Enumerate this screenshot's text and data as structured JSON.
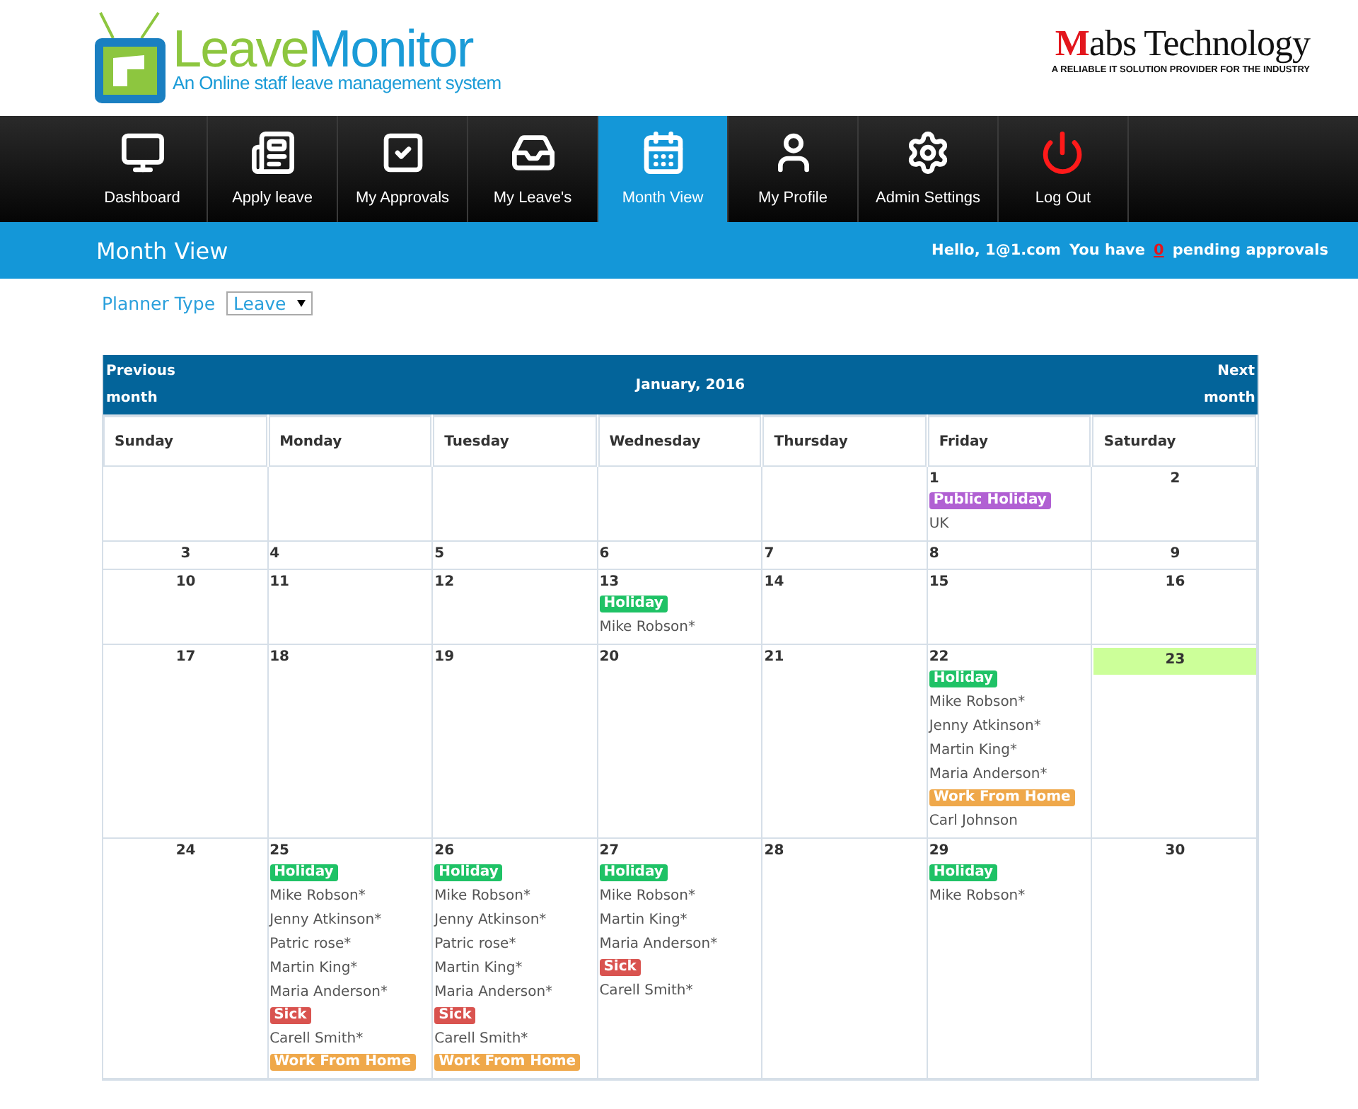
{
  "brand": {
    "name_part1": "Leave",
    "name_part2": "Monitor",
    "tagline": "An Online staff leave management system"
  },
  "partner": {
    "name": "Mabs Technology",
    "tagline": "A RELIABLE IT SOLUTION PROVIDER FOR THE INDUSTRY"
  },
  "nav": [
    {
      "kind": "dashboard",
      "label": "Dashboard",
      "selected": false
    },
    {
      "kind": "apply",
      "label": "Apply leave",
      "selected": false
    },
    {
      "kind": "approvals",
      "label": "My Approvals",
      "selected": false
    },
    {
      "kind": "leaves",
      "label": "My Leave's",
      "selected": false
    },
    {
      "kind": "month",
      "label": "Month View",
      "selected": true
    },
    {
      "kind": "profile",
      "label": "My Profile",
      "selected": false
    },
    {
      "kind": "admin",
      "label": "Admin Settings",
      "selected": false
    },
    {
      "kind": "logout",
      "label": "Log Out",
      "selected": false
    }
  ],
  "page_title": "Month View",
  "user": {
    "greeting": "Hello, 1@1.com",
    "approvals_prefix": "You have",
    "approvals_count": "0",
    "approvals_suffix": "pending approvals"
  },
  "planner": {
    "label": "Planner Type",
    "value": "Leave"
  },
  "calendar": {
    "previous": "Previous month",
    "title": "January, 2016",
    "next": "Next month",
    "weekdays": [
      "Sunday",
      "Monday",
      "Tuesday",
      "Wednesday",
      "Thursday",
      "Friday",
      "Saturday"
    ],
    "weeks": [
      [
        {
          "day": "1",
          "today": false,
          "entries": [
            {
              "kind": "badge",
              "text": "Public Holiday",
              "color": "#b160d3"
            },
            {
              "kind": "name",
              "text": "UK"
            }
          ]
        },
        {
          "day": "2",
          "today": false
        }
      ],
      [
        {
          "day": "3",
          "today": false
        },
        {
          "day": "4",
          "today": false
        },
        {
          "day": "5",
          "today": false
        },
        {
          "day": "6",
          "today": false
        },
        {
          "day": "7",
          "today": false
        },
        {
          "day": "8",
          "today": false
        },
        {
          "day": "9",
          "today": false
        }
      ],
      [
        {
          "day": "10",
          "today": false
        },
        {
          "day": "11",
          "today": false
        },
        {
          "day": "12",
          "today": false
        },
        {
          "day": "13",
          "today": false,
          "entries": [
            {
              "kind": "badge",
              "text": "Holiday",
              "color": "#1fc266"
            },
            {
              "kind": "name",
              "text": "Mike Robson*"
            }
          ]
        },
        {
          "day": "14",
          "today": false
        },
        {
          "day": "15",
          "today": false
        },
        {
          "day": "16",
          "today": false
        }
      ],
      [
        {
          "day": "17",
          "today": false
        },
        {
          "day": "18",
          "today": false
        },
        {
          "day": "19",
          "today": false
        },
        {
          "day": "20",
          "today": false
        },
        {
          "day": "21",
          "today": false
        },
        {
          "day": "22",
          "today": false,
          "entries": [
            {
              "kind": "badge",
              "text": "Holiday",
              "color": "#1fc266"
            },
            {
              "kind": "name",
              "text": "Mike Robson*"
            },
            {
              "kind": "name",
              "text": "Jenny Atkinson*"
            },
            {
              "kind": "name",
              "text": "Martin King*"
            },
            {
              "kind": "name",
              "text": "Maria Anderson*"
            },
            {
              "kind": "badge",
              "text": "Work From Home",
              "color": "#efa84a"
            },
            {
              "kind": "name",
              "text": "Carl Johnson"
            }
          ]
        },
        {
          "day": "23",
          "today": true
        }
      ],
      [
        {
          "day": "24",
          "today": false
        },
        {
          "day": "25",
          "today": false,
          "entries": [
            {
              "kind": "badge",
              "text": "Holiday",
              "color": "#1fc266"
            },
            {
              "kind": "name",
              "text": "Mike Robson*"
            },
            {
              "kind": "name",
              "text": "Jenny Atkinson*"
            },
            {
              "kind": "name",
              "text": "Patric rose*"
            },
            {
              "kind": "name",
              "text": "Martin King*"
            },
            {
              "kind": "name",
              "text": "Maria Anderson*"
            },
            {
              "kind": "badge",
              "text": "Sick",
              "color": "#d9534f"
            },
            {
              "kind": "name",
              "text": "Carell Smith*"
            },
            {
              "kind": "badge",
              "text": "Work From Home",
              "color": "#efa84a"
            }
          ]
        },
        {
          "day": "26",
          "today": false,
          "entries": [
            {
              "kind": "badge",
              "text": "Holiday",
              "color": "#1fc266"
            },
            {
              "kind": "name",
              "text": "Mike Robson*"
            },
            {
              "kind": "name",
              "text": "Jenny Atkinson*"
            },
            {
              "kind": "name",
              "text": "Patric rose*"
            },
            {
              "kind": "name",
              "text": "Martin King*"
            },
            {
              "kind": "name",
              "text": "Maria Anderson*"
            },
            {
              "kind": "badge",
              "text": "Sick",
              "color": "#d9534f"
            },
            {
              "kind": "name",
              "text": "Carell Smith*"
            },
            {
              "kind": "badge",
              "text": "Work From Home",
              "color": "#efa84a"
            }
          ]
        },
        {
          "day": "27",
          "today": false,
          "entries": [
            {
              "kind": "badge",
              "text": "Holiday",
              "color": "#1fc266"
            },
            {
              "kind": "name",
              "text": "Mike Robson*"
            },
            {
              "kind": "name",
              "text": "Martin King*"
            },
            {
              "kind": "name",
              "text": "Maria Anderson*"
            },
            {
              "kind": "badge",
              "text": "Sick",
              "color": "#d9534f"
            },
            {
              "kind": "name",
              "text": "Carell Smith*"
            }
          ]
        },
        {
          "day": "28",
          "today": false
        },
        {
          "day": "29",
          "today": false,
          "entries": [
            {
              "kind": "badge",
              "text": "Holiday",
              "color": "#1fc266"
            },
            {
              "kind": "name",
              "text": "Mike Robson*"
            }
          ]
        },
        {
          "day": "30",
          "today": false
        }
      ]
    ]
  }
}
